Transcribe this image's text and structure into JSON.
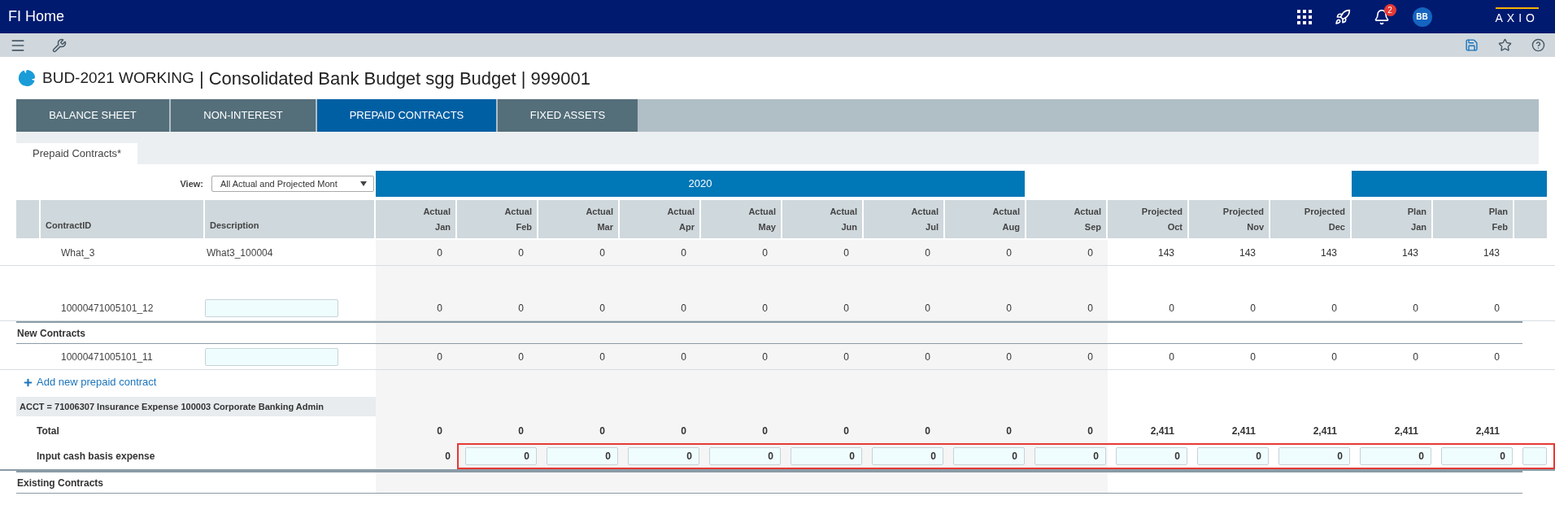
{
  "top_bar": {
    "title": "FI Home",
    "notification_count": "2",
    "user_initials": "BB",
    "logo_text": "AXIO"
  },
  "page_title": {
    "code": "BUD-2021 WORKING",
    "name": "| Consolidated Bank Budget sgg Budget | 999001"
  },
  "tabs": [
    {
      "label": "BALANCE SHEET",
      "selected": false
    },
    {
      "label": "NON-INTEREST",
      "selected": false
    },
    {
      "label": "PREPAID CONTRACTS",
      "selected": true
    },
    {
      "label": "FIXED ASSETS",
      "selected": false
    }
  ],
  "subtabs": [
    {
      "label": "Prepaid Contracts*",
      "selected": true
    }
  ],
  "view": {
    "label": "View:",
    "value": "All Actual and Projected Mont"
  },
  "year_bands": [
    {
      "kind": "labeled",
      "label": "2020"
    },
    {
      "kind": "continuation"
    }
  ],
  "table": {
    "columns": [
      {
        "label": "ContractID"
      },
      {
        "label": "Description"
      }
    ],
    "periods": [
      {
        "kind": "actual",
        "label": "Actual",
        "month": "Jan"
      },
      {
        "kind": "actual",
        "label": "Actual",
        "month": "Feb"
      },
      {
        "kind": "actual",
        "label": "Actual",
        "month": "Mar"
      },
      {
        "kind": "actual",
        "label": "Actual",
        "month": "Apr"
      },
      {
        "kind": "actual",
        "label": "Actual",
        "month": "May"
      },
      {
        "kind": "actual",
        "label": "Actual",
        "month": "Jun"
      },
      {
        "kind": "actual",
        "label": "Actual",
        "month": "Jul"
      },
      {
        "kind": "actual",
        "label": "Actual",
        "month": "Aug"
      },
      {
        "kind": "actual",
        "label": "Actual",
        "month": "Sep"
      },
      {
        "kind": "projected",
        "label": "Projected",
        "month": "Oct"
      },
      {
        "kind": "projected",
        "label": "Projected",
        "month": "Nov"
      },
      {
        "kind": "projected",
        "label": "Projected",
        "month": "Dec"
      },
      {
        "kind": "plan",
        "label": "Plan",
        "month": "Jan"
      },
      {
        "kind": "plan",
        "label": "Plan",
        "month": "Feb"
      }
    ],
    "rows": [
      {
        "kind": "contract",
        "id": "What_3",
        "description": "What3_100004",
        "values": [
          "0",
          "0",
          "0",
          "0",
          "0",
          "0",
          "0",
          "0",
          "0",
          "143",
          "143",
          "143",
          "143",
          "143"
        ]
      },
      {
        "kind": "gap"
      },
      {
        "kind": "contract",
        "id": "10000471005101_12",
        "values": [
          "0",
          "0",
          "0",
          "0",
          "0",
          "0",
          "0",
          "0",
          "0",
          "0",
          "0",
          "0",
          "0",
          "0"
        ]
      },
      {
        "kind": "section",
        "label": "New Contracts"
      },
      {
        "kind": "contract",
        "id": "10000471005101_11",
        "values": [
          "0",
          "0",
          "0",
          "0",
          "0",
          "0",
          "0",
          "0",
          "0",
          "0",
          "0",
          "0",
          "0",
          "0"
        ]
      },
      {
        "kind": "add_link",
        "label": "Add new prepaid contract"
      },
      {
        "kind": "account",
        "label": "ACCT = 71006307 Insurance Expense 100003 Corporate Banking Admin"
      },
      {
        "kind": "total",
        "label": "Total",
        "values": [
          "0",
          "0",
          "0",
          "0",
          "0",
          "0",
          "0",
          "0",
          "0",
          "2,411",
          "2,411",
          "2,411",
          "2,411",
          "2,411"
        ]
      },
      {
        "kind": "input",
        "label": "Input cash basis expense",
        "highlighted": true,
        "values": [
          "0",
          "0",
          "0",
          "0",
          "0",
          "0",
          "0",
          "0",
          "0",
          "0",
          "0",
          "0",
          "0",
          "0"
        ]
      },
      {
        "kind": "section",
        "label": "Existing Contracts"
      }
    ]
  }
}
